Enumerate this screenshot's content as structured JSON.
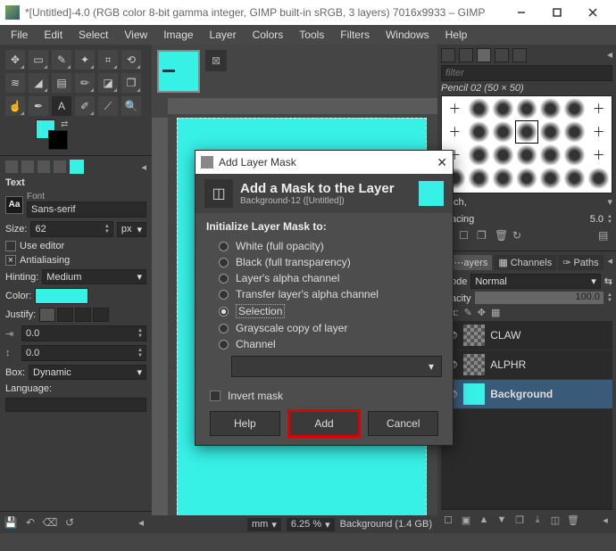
{
  "window": {
    "title": "*[Untitled]-4.0 (RGB color 8-bit gamma integer, GIMP built-in sRGB, 3 layers) 7016x9933 – GIMP"
  },
  "menu": [
    "File",
    "Edit",
    "Select",
    "View",
    "Image",
    "Layer",
    "Colors",
    "Tools",
    "Filters",
    "Windows",
    "Help"
  ],
  "text_tool": {
    "heading": "Text",
    "font_label": "Font",
    "font_value": "Sans-serif",
    "size_label": "Size:",
    "size_value": "62",
    "size_unit": "px",
    "use_editor": "Use editor",
    "antialias": "Antialiasing",
    "hinting_label": "Hinting:",
    "hinting_value": "Medium",
    "color_label": "Color:",
    "justify_label": "Justify:",
    "indent1": "0.0",
    "indent2": "0.0",
    "box_label": "Box:",
    "box_value": "Dynamic",
    "lang_label": "Language:"
  },
  "brushes": {
    "filter_placeholder": "filter",
    "current": "Pencil 02 (50 × 50)",
    "hatch_label": "⋯tch,",
    "spacing_label": "⋯acing",
    "spacing_value": "5.0"
  },
  "layers": {
    "tabs": [
      "⋯ayers",
      "Channels",
      "Paths"
    ],
    "mode_label": "⋯ode",
    "mode_value": "Normal",
    "opacity_label": "⋯acity",
    "opacity_value": "100.0",
    "lock_label": "⋯k:",
    "items": [
      {
        "name": "CLAW"
      },
      {
        "name": "ALPHR"
      },
      {
        "name": "Background"
      }
    ]
  },
  "status": {
    "unit": "mm",
    "zoom": "6.25 %",
    "layer": "Background (1.4 GB)"
  },
  "dialog": {
    "title": "Add Layer Mask",
    "heading": "Add a Mask to the Layer",
    "sub": "Background-12 ([Untitled])",
    "lead": "Initialize Layer Mask to:",
    "opts": [
      "White (full opacity)",
      "Black (full transparency)",
      "Layer's alpha channel",
      "Transfer layer's alpha channel",
      "Selection",
      "Grayscale copy of layer",
      "Channel"
    ],
    "invert": "Invert mask",
    "help": "Help",
    "add": "Add",
    "cancel": "Cancel"
  }
}
